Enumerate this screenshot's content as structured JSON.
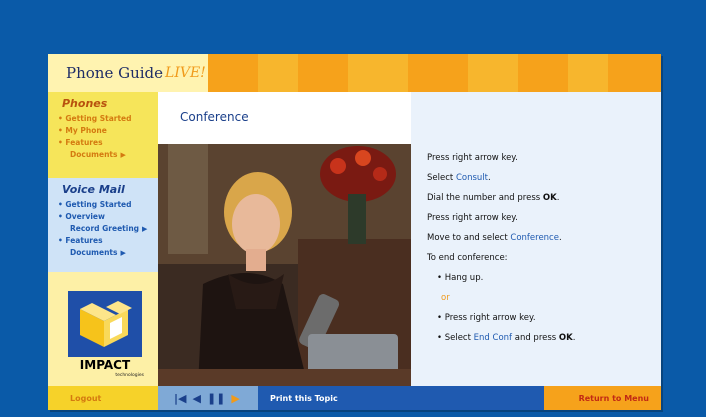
{
  "header": {
    "logo_text": "Phone Guide",
    "logo_live": "LIVE!"
  },
  "sidebar": {
    "phones": {
      "title": "Phones",
      "items": [
        "• Getting Started",
        "• My Phone",
        "• Features",
        "Documents"
      ]
    },
    "voicemail": {
      "title": "Voice Mail",
      "items": [
        "• Getting Started",
        "• Overview",
        "Record Greeting",
        "• Features",
        "Documents"
      ]
    },
    "brand": {
      "name": "IMPACT",
      "sub": "technologies"
    }
  },
  "main": {
    "title": "Conference"
  },
  "panel": {
    "steps": [
      {
        "pre": "Press right arrow key.",
        "hl": "",
        "post": ""
      },
      {
        "pre": "Select ",
        "hl": "Consult",
        "post": "."
      },
      {
        "pre": "Dial the number and press ",
        "hl": "",
        "post": "",
        "bold": "OK",
        "tail": "."
      },
      {
        "pre": "Press right arrow key.",
        "hl": "",
        "post": ""
      },
      {
        "pre": "Move to and select ",
        "hl": "Conference",
        "post": "."
      },
      {
        "pre": "To end conference:",
        "hl": "",
        "post": ""
      }
    ],
    "bullet_1": "Hang up.",
    "or": "or",
    "bullet_2": "Press right arrow key.",
    "bullet_3_pre": "Select ",
    "bullet_3_hl": "End Conf",
    "bullet_3_mid": " and press ",
    "bullet_3_bold": "OK",
    "bullet_3_tail": "."
  },
  "bottom": {
    "logout": "Logout",
    "controls": [
      "|◀",
      "◀",
      "❚❚",
      "▶"
    ],
    "print": "Print this Topic",
    "menu": "Return to Menu"
  },
  "colors": {
    "background": "#0a5aa8",
    "header_orange": "#f6a21b",
    "accent_blue": "#1f5ab0"
  }
}
